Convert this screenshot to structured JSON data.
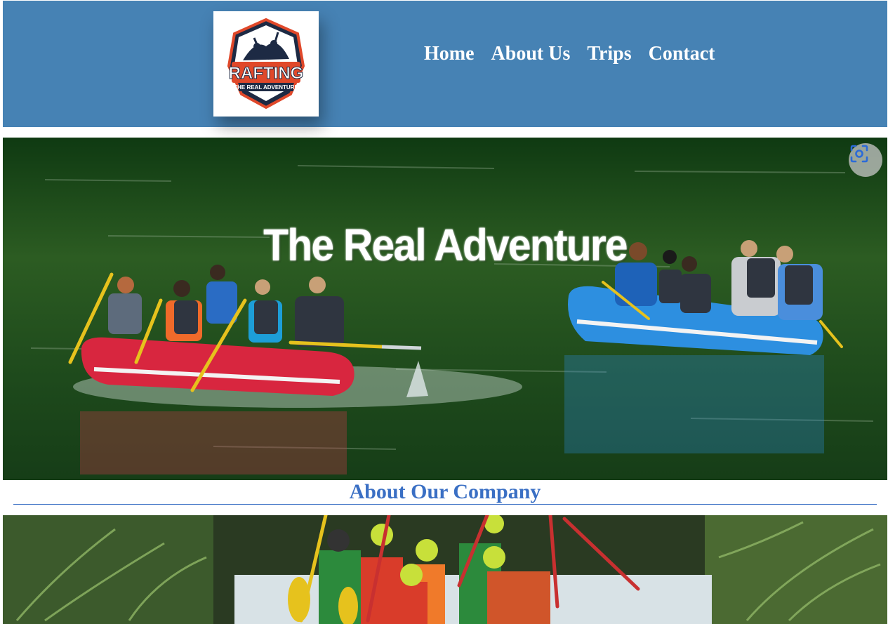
{
  "header": {
    "logo": {
      "brand_text": "RAFTING",
      "tagline": "THE REAL ADVENTURE",
      "icon": "rafting-logo-badge"
    },
    "nav": [
      {
        "label": "Home"
      },
      {
        "label": "About Us"
      },
      {
        "label": "Trips"
      },
      {
        "label": "Contact"
      }
    ]
  },
  "hero": {
    "title": "The Real Adventure",
    "lens_icon": "visual-search-icon"
  },
  "about": {
    "heading": "About Our Company"
  },
  "colors": {
    "header_bg": "#4682b4",
    "heading_blue": "#3a6fc4",
    "river_green": "#1f4a22",
    "raft_red": "#d8263f",
    "raft_blue": "#2d8fe0"
  }
}
